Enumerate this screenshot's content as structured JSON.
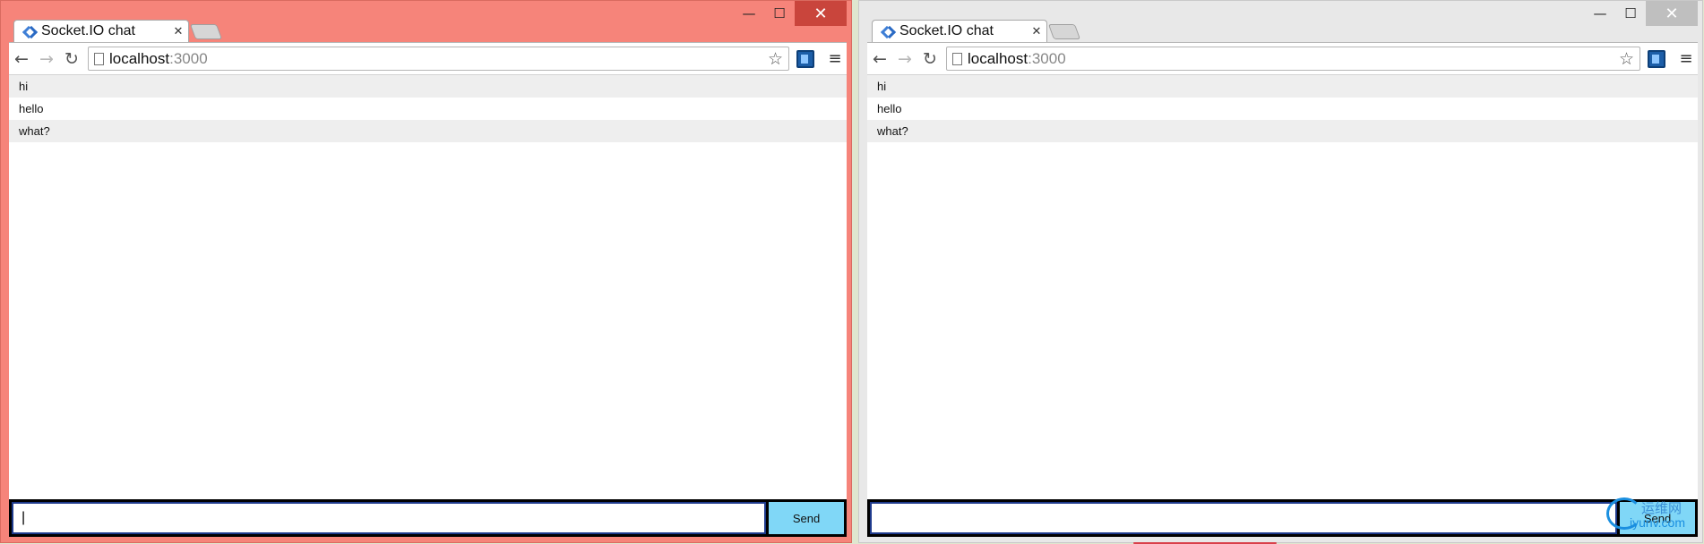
{
  "windows": [
    {
      "tab_title": "Socket.IO chat",
      "url_host": "localhost",
      "url_port": ":3000",
      "messages": [
        "hi",
        "hello",
        "what?"
      ],
      "input_value": "|",
      "send_label": "Send"
    },
    {
      "tab_title": "Socket.IO chat",
      "url_host": "localhost",
      "url_port": ":3000",
      "messages": [
        "hi",
        "hello",
        "what?"
      ],
      "input_value": "",
      "send_label": "Send"
    }
  ],
  "caption": {
    "minimize": "—",
    "maximize": "☐",
    "close": "✕"
  },
  "watermark": {
    "text": "运维网",
    "sub": "iyunv.com"
  },
  "colors": {
    "active_frame": "#f6847a",
    "inactive_frame": "#e8e8e8",
    "send_button": "#80d7f7"
  }
}
